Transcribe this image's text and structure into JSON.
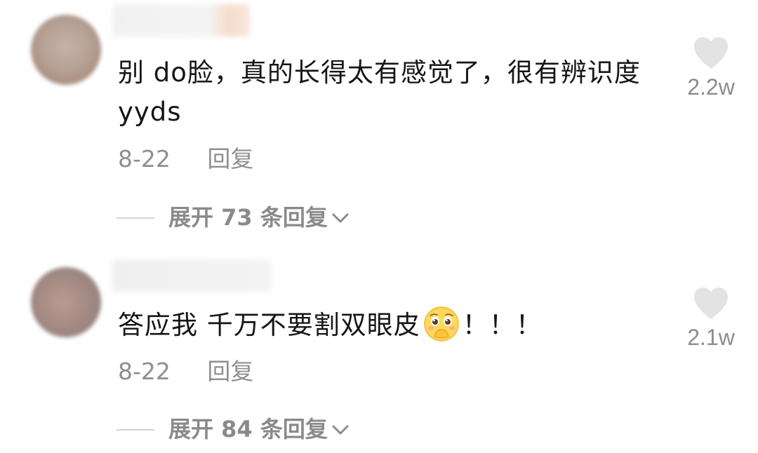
{
  "comments": [
    {
      "text": "别 do脸，真的长得太有感觉了，很有辨识度 yyds",
      "date": "8-22",
      "reply_label": "回复",
      "expand_label": "展开 73 条回复",
      "like_count": "2.2w",
      "icons": {
        "like": "heart-icon",
        "expand": "chevron-down-icon"
      }
    },
    {
      "text": "答应我 千万不要割双眼皮",
      "text_suffix": "！！！",
      "emoji": "pleading-face-emoji",
      "date": "8-22",
      "reply_label": "回复",
      "expand_label": "展开 84 条回复",
      "like_count": "2.1w",
      "icons": {
        "like": "heart-icon",
        "expand": "chevron-down-icon"
      }
    }
  ],
  "colors": {
    "text": "#161616",
    "meta": "#8f8f8f",
    "heart": "#e3e3e3",
    "divider": "#d6d6d6"
  }
}
